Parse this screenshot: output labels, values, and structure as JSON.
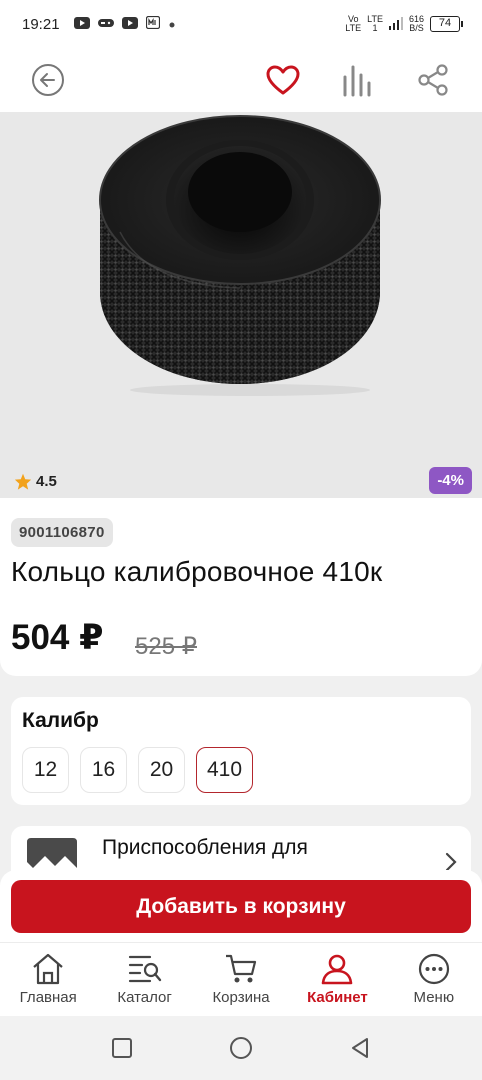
{
  "status_bar": {
    "time": "19:21",
    "network_1_top": "Vo",
    "network_1_bottom": "LTE",
    "network_2_top": "LTE",
    "network_2_bottom": "1",
    "speed_value": "616",
    "speed_unit": "B/S",
    "battery": "74"
  },
  "header": {
    "icons": [
      "back-arrow-icon",
      "heart-icon",
      "compare-icon",
      "share-icon"
    ],
    "accent_color": "#c8141e"
  },
  "product": {
    "rating": "4.5",
    "discount": "-4%",
    "sku": "9001106870",
    "title": "Кольцо калибровочное 410к",
    "price": "504 ₽",
    "old_price": "525 ₽"
  },
  "caliber": {
    "label": "Калибр",
    "options": [
      "12",
      "16",
      "20",
      "410"
    ],
    "selected": "410"
  },
  "related": {
    "label": "Приспособления для"
  },
  "cart": {
    "add_label": "Добавить в корзину"
  },
  "bottom_nav": {
    "items": [
      {
        "label": "Главная",
        "icon": "home-icon"
      },
      {
        "label": "Каталог",
        "icon": "catalog-icon"
      },
      {
        "label": "Корзина",
        "icon": "cart-icon"
      },
      {
        "label": "Кабинет",
        "icon": "user-icon"
      },
      {
        "label": "Меню",
        "icon": "menu-icon"
      }
    ],
    "active": "Кабинет"
  },
  "colors": {
    "brand_red": "#c8141e",
    "discount_purple": "#8e57c4"
  }
}
